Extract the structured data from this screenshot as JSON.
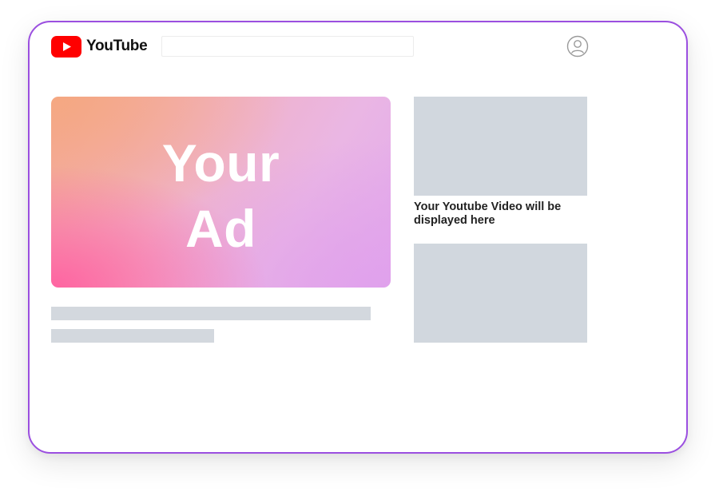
{
  "header": {
    "logo_text": "YouTube",
    "search": {
      "value": "",
      "placeholder": ""
    }
  },
  "ad": {
    "line1": "Your",
    "line2": "Ad"
  },
  "sidebar": {
    "video_title": "Your Youtube Video will be displayed here"
  },
  "colors": {
    "frame_border": "#9b4fe0",
    "logo_red": "#ff0000",
    "placeholder_gray": "#d1d7de"
  },
  "icons": {
    "logo": "youtube-logo-icon",
    "account": "account-circle-icon"
  }
}
